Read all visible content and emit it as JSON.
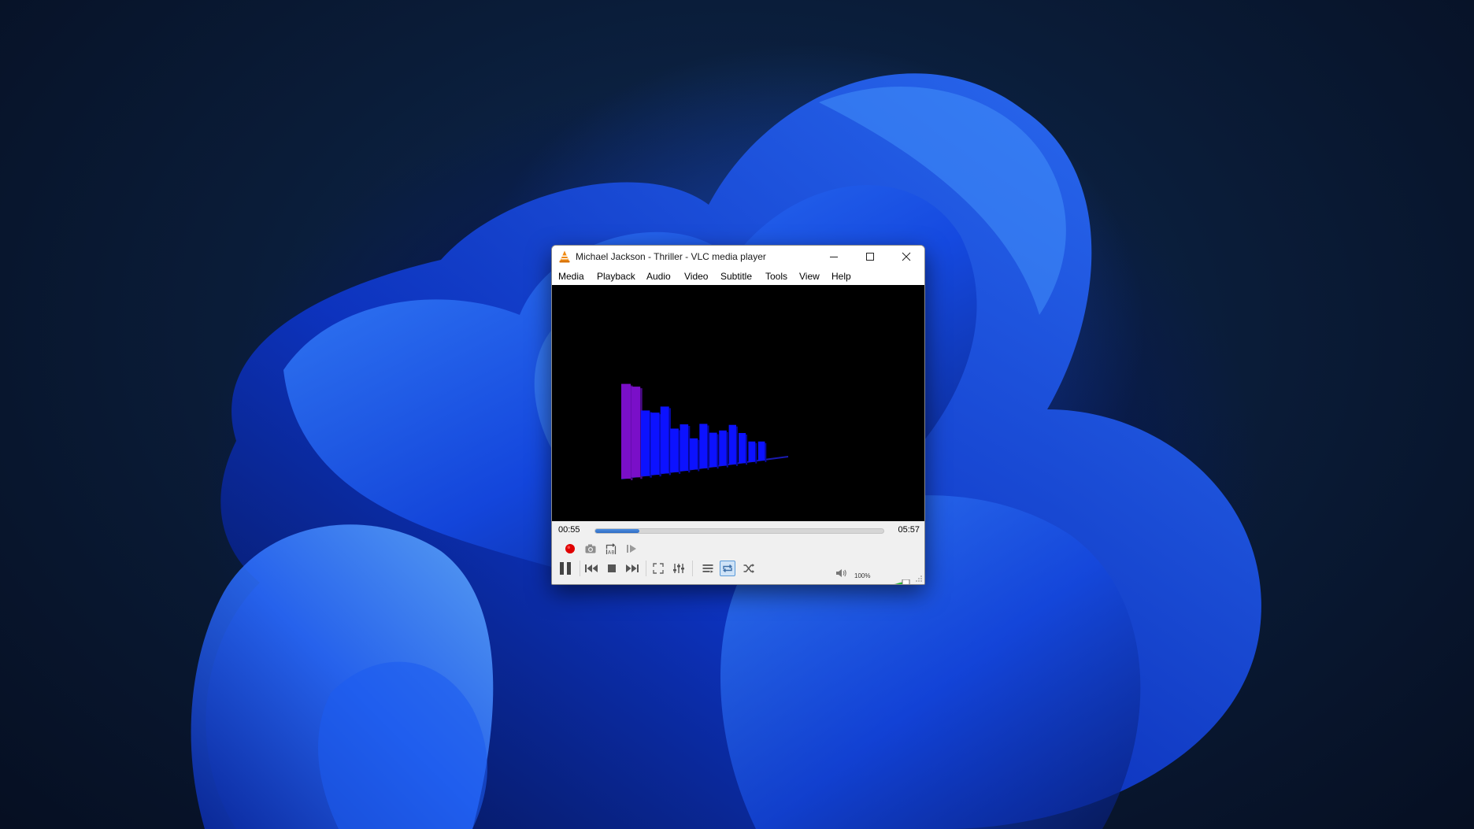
{
  "window": {
    "title": "Michael Jackson - Thriller - VLC media player"
  },
  "menu": {
    "items": [
      "Media",
      "Playback",
      "Audio",
      "Video",
      "Subtitle",
      "Tools",
      "View",
      "Help"
    ]
  },
  "player": {
    "elapsed": "00:55",
    "total": "05:57",
    "progress_fraction": 0.154,
    "volume_label": "100%",
    "volume_fraction": 1.0,
    "loop_active": true
  },
  "visualizer": {
    "bar_levels": [
      0.86,
      0.84,
      0.62,
      0.6,
      0.66,
      0.44,
      0.48,
      0.33,
      0.48,
      0.38,
      0.4,
      0.46,
      0.36,
      0.25,
      0.24
    ],
    "colors": {
      "low": "#0c12ff",
      "high": "#7a0fc8"
    }
  },
  "icons": {
    "app": "vlc-cone-icon",
    "record": "record-icon",
    "snapshot": "camera-icon",
    "ab_loop": "ab-loop-icon",
    "frame_step": "frame-by-frame-icon",
    "pause": "pause-icon",
    "previous": "previous-icon",
    "stop": "stop-icon",
    "next": "next-icon",
    "fullscreen": "fullscreen-icon",
    "extended": "extended-settings-icon",
    "playlist": "playlist-icon",
    "loop": "loop-icon",
    "shuffle": "shuffle-icon",
    "volume": "speaker-icon"
  },
  "colors": {
    "seek_fill": "#3a7bd5",
    "volume_fill": "#22c02a",
    "record": "#e00000"
  }
}
